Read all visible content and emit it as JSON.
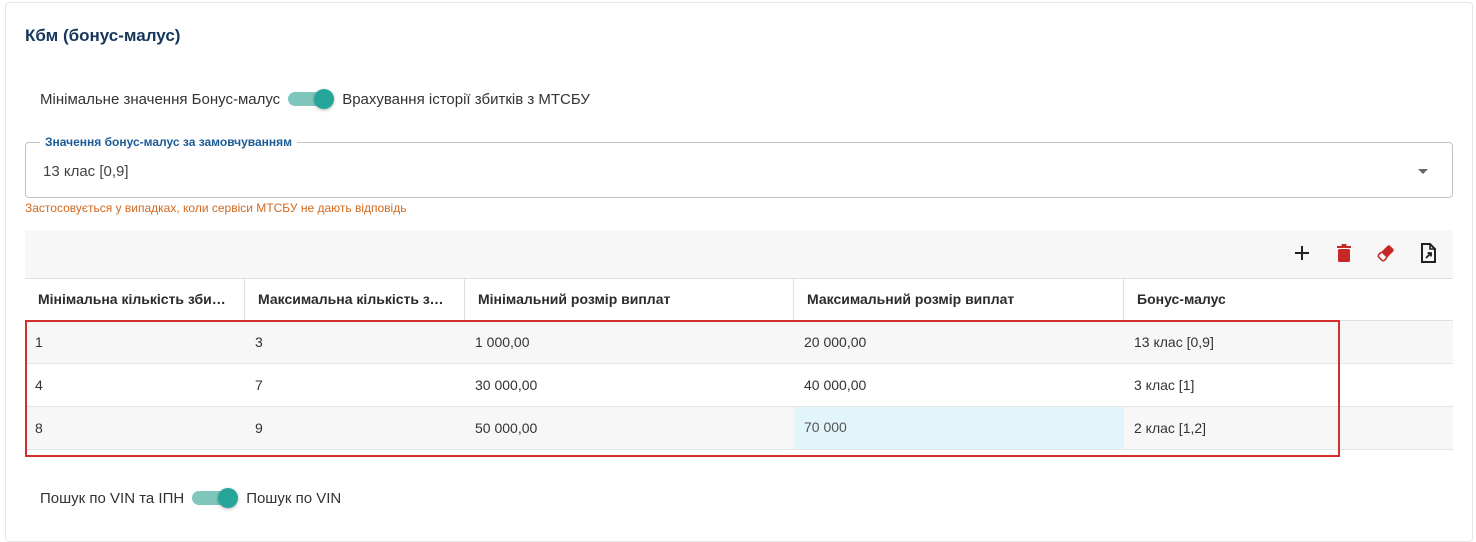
{
  "section": {
    "title": "Кбм (бонус-малус)"
  },
  "toggle_kbm": {
    "left_label": "Мінімальне значення Бонус-малус",
    "right_label": "Врахування історії збитків з МТСБУ",
    "state": "right"
  },
  "default_select": {
    "legend": "Значення бонус-малус за замовчуванням",
    "value": "13 клас [0,9]",
    "hint": "Застосовується у випадках, коли сервіси МТСБУ не дають відповідь"
  },
  "toolbar": {
    "icons": [
      "plus-icon",
      "trash-icon",
      "eraser-icon",
      "export-file-icon"
    ],
    "colors": {
      "plus": "#212121",
      "trash": "#c62828",
      "eraser": "#c62828",
      "export": "#212121"
    }
  },
  "table": {
    "columns": [
      "Мінімальна кількість збит…",
      "Максимальна кількість зб…",
      "Мінімальний розмір виплат",
      "Максимальний розмір виплат",
      "Бонус-малус"
    ],
    "rows": [
      [
        "1",
        "3",
        "1 000,00",
        "20 000,00",
        "13 клас [0,9]"
      ],
      [
        "4",
        "7",
        "30 000,00",
        "40 000,00",
        "3 клас [1]"
      ],
      [
        "8",
        "9",
        "50 000,00",
        "70 000",
        "2 клас [1,2]"
      ]
    ]
  },
  "toggle_search": {
    "left_label": "Пошук по VIN та ІПН",
    "right_label": "Пошук по VIN",
    "state": "right"
  },
  "colors": {
    "accent": "#26a69a",
    "title": "#16365c",
    "legend": "#1a5a96",
    "hint": "#d2691e",
    "highlight": "#d32f2f",
    "editing_cell": "#e1f5fb"
  }
}
